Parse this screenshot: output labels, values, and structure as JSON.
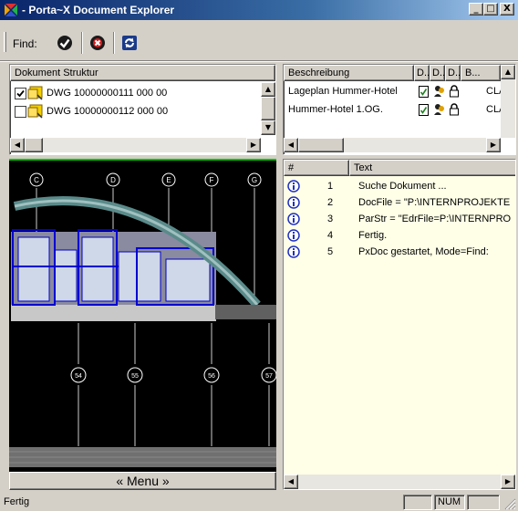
{
  "window": {
    "title": "- Porta~X Document Explorer",
    "caption_buttons": {
      "minimize": "_",
      "maximize": "□",
      "close": "X"
    }
  },
  "toolbar": {
    "find_label": "Find:",
    "icons": [
      "check-icon",
      "cancel-icon",
      "refresh-icon"
    ]
  },
  "dokument_struktur": {
    "header": "Dokument Struktur",
    "items": [
      {
        "label": "DWG 10000000111 000 00",
        "checked": true
      },
      {
        "label": "DWG 10000000112 000 00",
        "checked": false
      }
    ]
  },
  "beschreibung": {
    "columns": [
      "Beschreibung",
      "D..",
      "D..",
      "D..",
      "B..."
    ],
    "rows": [
      {
        "beschreibung": "Lageplan Hummer-Hotel",
        "b": "CLA"
      },
      {
        "beschreibung": "Hummer-Hotel 1.OG.",
        "b": "CLA"
      }
    ]
  },
  "drawing": {
    "top_axis_labels": [
      "C",
      "D",
      "E",
      "F",
      "G"
    ],
    "bottom_axis_labels": [
      "54",
      "55",
      "56",
      "57"
    ],
    "menu_label": "« Menu »"
  },
  "log": {
    "columns": [
      "#",
      "Text"
    ],
    "rows": [
      {
        "num": "1",
        "text": "Suche Dokument ..."
      },
      {
        "num": "2",
        "text": "DocFile = \"P:\\INTERNPROJEKTE"
      },
      {
        "num": "3",
        "text": "ParStr = \"EdrFile=P:\\INTERNPRO"
      },
      {
        "num": "4",
        "text": "Fertig."
      },
      {
        "num": "5",
        "text": "PxDoc gestartet, Mode=Find:"
      }
    ]
  },
  "statusbar": {
    "text": "Fertig",
    "panes": [
      "",
      "NUM",
      ""
    ]
  },
  "colors": {
    "title_start": "#0a246a",
    "title_end": "#a6caf0",
    "face": "#d4d0c8",
    "info_blue": "#2030c0"
  }
}
